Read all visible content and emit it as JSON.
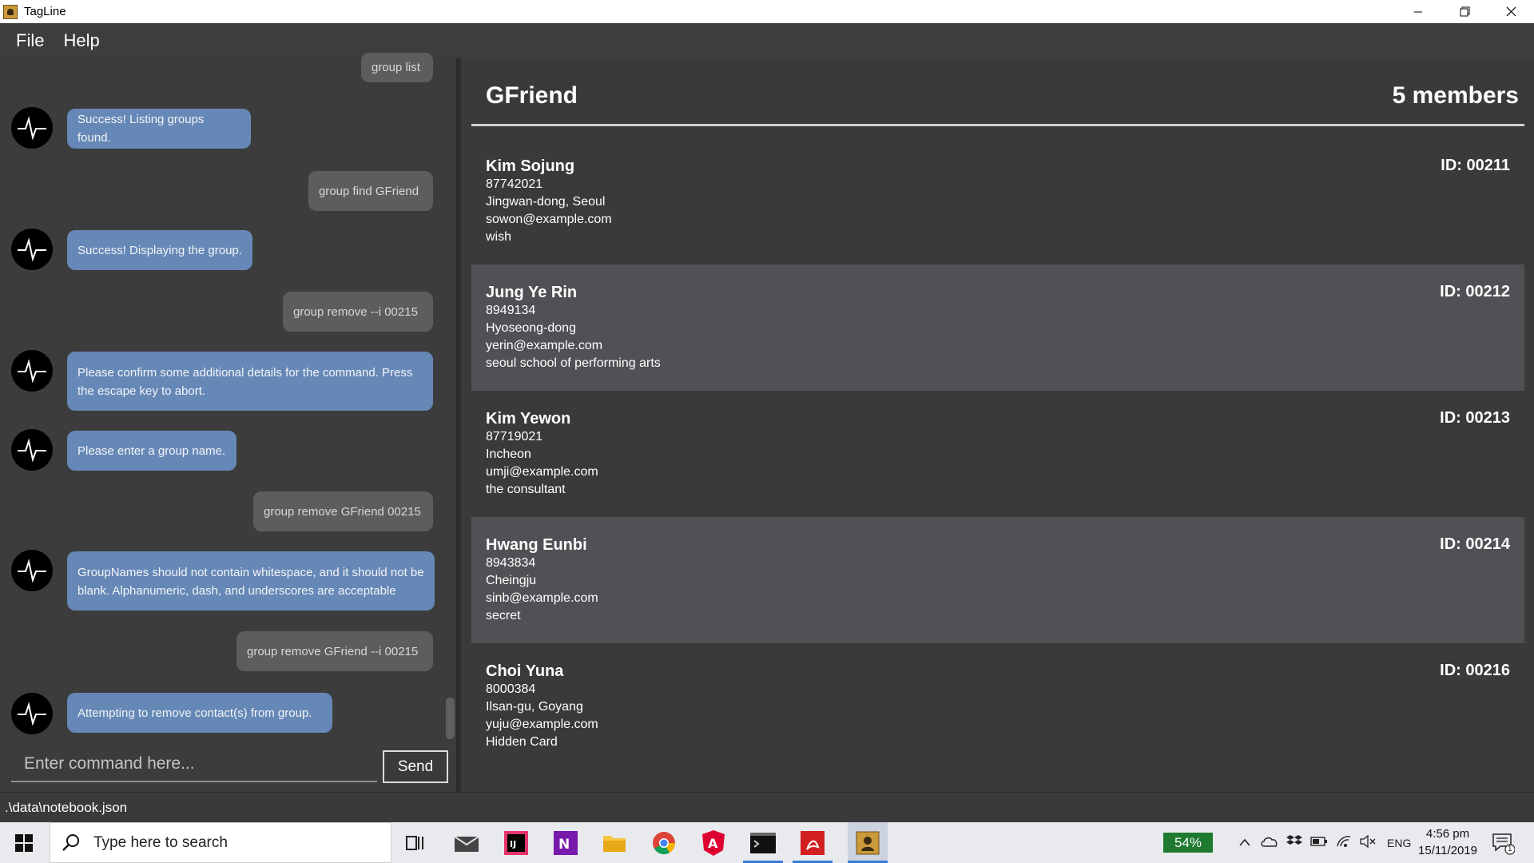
{
  "window": {
    "title": "TagLine",
    "controls": [
      "minimize-icon",
      "restore-icon",
      "close-icon"
    ]
  },
  "menu": {
    "items": [
      "File",
      "Help"
    ]
  },
  "chat": {
    "messages": [
      {
        "from": "user",
        "text": "group list"
      },
      {
        "from": "bot",
        "text": "Success! Listing groups found."
      },
      {
        "from": "user",
        "text": "group find GFriend"
      },
      {
        "from": "bot",
        "text": "Success! Displaying the group."
      },
      {
        "from": "user",
        "text": "group remove --i 00215"
      },
      {
        "from": "bot",
        "text": "Please confirm some additional details for the command. Press the escape key to abort."
      },
      {
        "from": "bot",
        "text": "Please enter a group name."
      },
      {
        "from": "user",
        "text": "group remove GFriend 00215"
      },
      {
        "from": "bot",
        "text": "GroupNames should not contain whitespace, and it should not be blank. Alphanumeric, dash, and underscores are acceptable"
      },
      {
        "from": "user",
        "text": "group remove GFriend --i 00215"
      },
      {
        "from": "bot",
        "text": "Attempting to remove contact(s) from group."
      }
    ],
    "input_placeholder": "Enter command here...",
    "input_value": "",
    "send_label": "Send"
  },
  "group": {
    "name": "GFriend",
    "member_count": "5 members",
    "members": [
      {
        "name": "Kim Sojung",
        "phone": "87742021",
        "address": "Jingwan-dong, Seoul",
        "email": "sowon@example.com",
        "description": "wish",
        "id": "ID: 00211"
      },
      {
        "name": "Jung Ye Rin",
        "phone": "8949134",
        "address": "Hyoseong-dong",
        "email": "yerin@example.com",
        "description": "seoul school of performing arts",
        "id": "ID: 00212"
      },
      {
        "name": "Kim Yewon",
        "phone": "87719021",
        "address": "Incheon",
        "email": "umji@example.com",
        "description": "the consultant",
        "id": "ID: 00213"
      },
      {
        "name": "Hwang Eunbi",
        "phone": "8943834",
        "address": "Cheingju",
        "email": "sinb@example.com",
        "description": "secret",
        "id": "ID: 00214"
      },
      {
        "name": "Choi Yuna",
        "phone": "8000384",
        "address": "Ilsan-gu, Goyang",
        "email": "yuju@example.com",
        "description": "Hidden Card",
        "id": "ID: 00216"
      }
    ]
  },
  "status_bar": {
    "path": ".\\data\\notebook.json"
  },
  "taskbar": {
    "search_placeholder": "Type here to search",
    "pinned_icons": [
      "task-view-icon",
      "mail-icon",
      "intellij-icon",
      "onenote-icon",
      "file-explorer-icon",
      "chrome-icon",
      "angular-icon",
      "terminal-icon",
      "acrobat-icon",
      "tagline-app-icon"
    ],
    "battery": "54%",
    "language": "ENG",
    "time": "4:56 pm",
    "date": "15/11/2019",
    "notification_count": "1"
  },
  "colors": {
    "bot_bubble": "#6688b6",
    "user_bubble": "#5d5d5d",
    "panel_bg": "#3a3a3a",
    "card_alt_bg": "#4f5154",
    "battery_badge": "#1d7a2e",
    "taskbar_active": "#3a7bd5"
  }
}
